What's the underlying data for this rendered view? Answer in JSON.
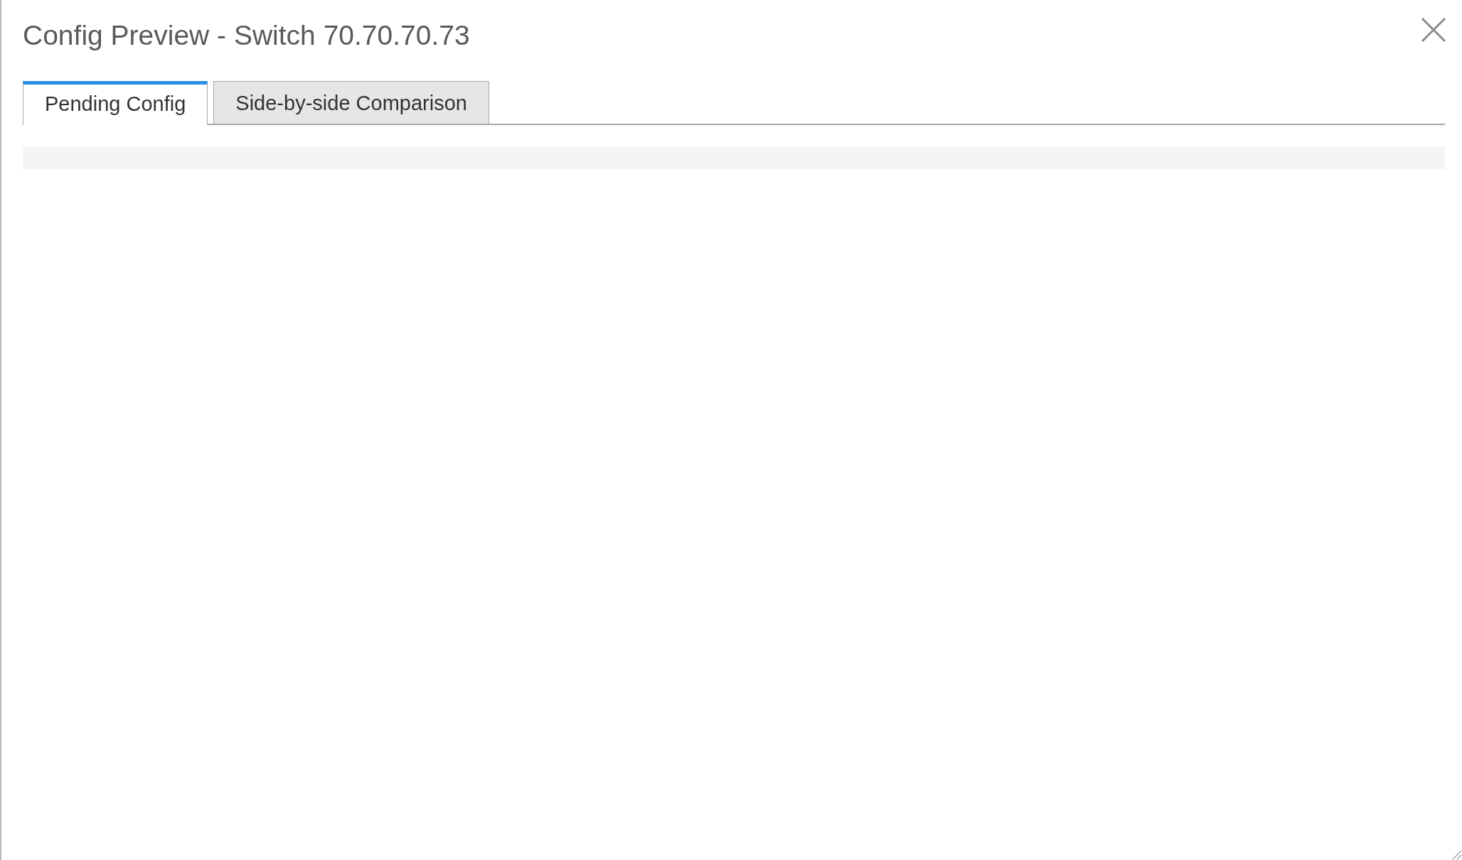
{
  "dialog": {
    "title": "Config Preview - Switch 70.70.70.73"
  },
  "tabs": [
    {
      "label": "Pending Config",
      "selected": true
    },
    {
      "label": "Side-by-side Comparison",
      "selected": false
    }
  ]
}
